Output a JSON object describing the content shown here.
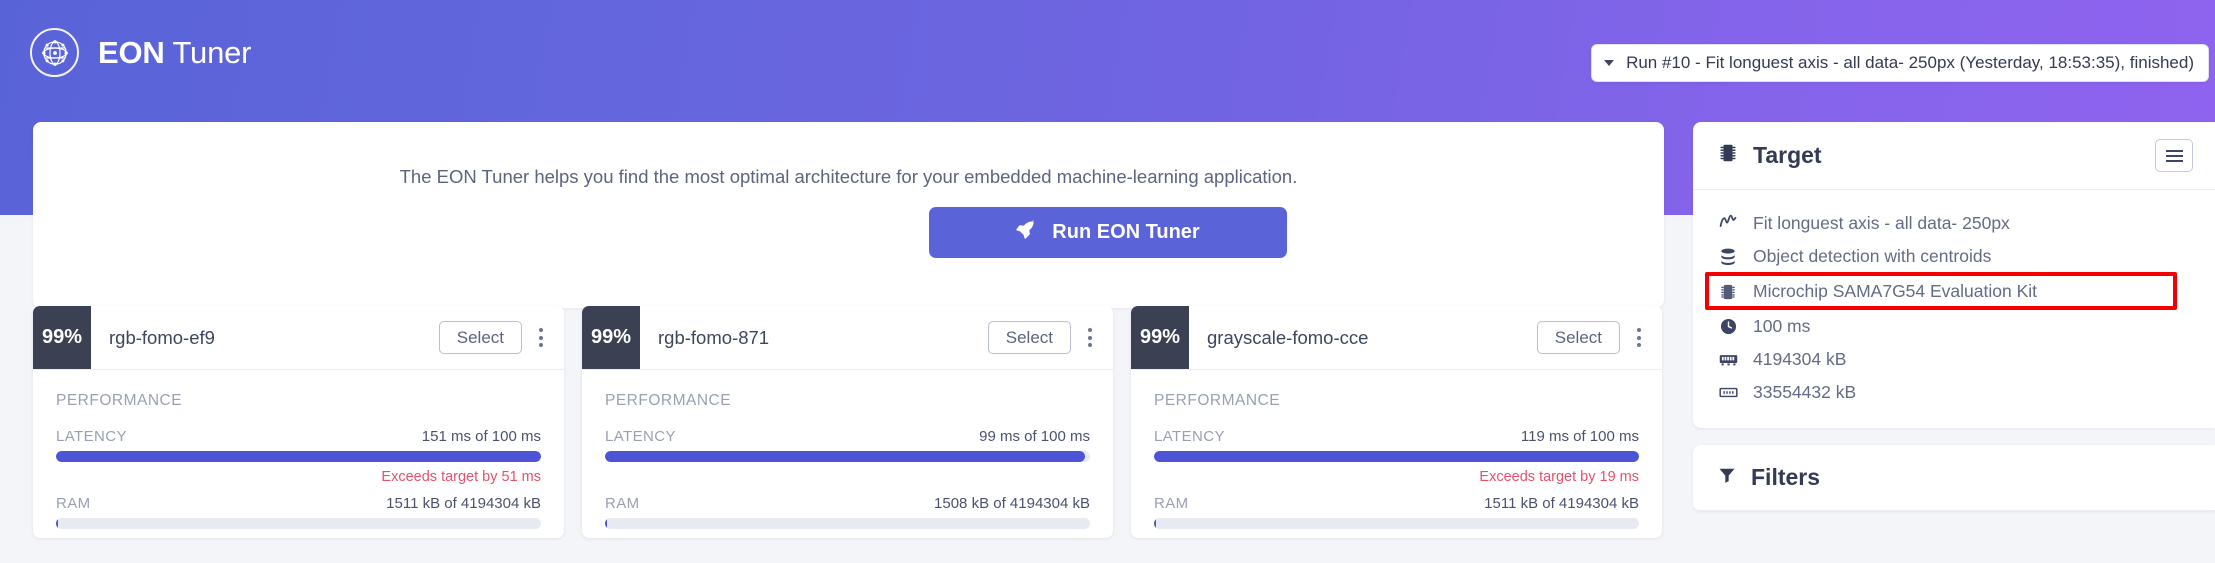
{
  "header": {
    "brand_bold": "EON",
    "brand_regular": "Tuner",
    "logo_icon": "eon-atom-logo-icon",
    "run_selector": {
      "caret_icon": "chevron-down-icon",
      "value": "Run #10 - Fit longuest axis - all data- 250px (Yesterday, 18:53:35), finished)"
    }
  },
  "intro": {
    "description": "The EON Tuner helps you find the most optimal architecture for your embedded machine-learning application.",
    "run_button_label": "Run EON Tuner",
    "run_button_icon": "rocket-icon",
    "accent_color": "#5a63d8"
  },
  "cards": [
    {
      "score": "99%",
      "name": "rgb-fomo-ef9",
      "select_label": "Select",
      "menu_icon": "kebab-menu-icon",
      "section_label": "PERFORMANCE",
      "metrics": [
        {
          "label": "LATENCY",
          "value": "151 ms of 100 ms",
          "fill_percent": 100,
          "warning": "Exceeds target by 51 ms"
        },
        {
          "label": "RAM",
          "value": "1511 kB of 4194304 kB",
          "fill_percent": 0,
          "warning": ""
        }
      ]
    },
    {
      "score": "99%",
      "name": "rgb-fomo-871",
      "select_label": "Select",
      "menu_icon": "kebab-menu-icon",
      "section_label": "PERFORMANCE",
      "metrics": [
        {
          "label": "LATENCY",
          "value": "99 ms of 100 ms",
          "fill_percent": 99,
          "warning": ""
        },
        {
          "label": "RAM",
          "value": "1508 kB of 4194304 kB",
          "fill_percent": 0,
          "warning": ""
        }
      ]
    },
    {
      "score": "99%",
      "name": "grayscale-fomo-cce",
      "select_label": "Select",
      "menu_icon": "kebab-menu-icon",
      "section_label": "PERFORMANCE",
      "metrics": [
        {
          "label": "LATENCY",
          "value": "119 ms of 100 ms",
          "fill_percent": 100,
          "warning": "Exceeds target by 19 ms"
        },
        {
          "label": "RAM",
          "value": "1511 kB of 4194304 kB",
          "fill_percent": 0,
          "warning": ""
        }
      ]
    }
  ],
  "sidebar": {
    "target_panel": {
      "title": "Target",
      "title_icon": "chip-icon",
      "menu_button_icon": "hamburger-menu-icon",
      "items": [
        {
          "icon": "signal-wave-icon",
          "label": "Fit longuest axis - all data- 250px",
          "highlighted": false
        },
        {
          "icon": "database-stack-icon",
          "label": "Object detection with centroids",
          "highlighted": false
        },
        {
          "icon": "chip-icon",
          "label": "Microchip SAMA7G54 Evaluation Kit",
          "highlighted": true
        },
        {
          "icon": "clock-icon",
          "label": "100 ms",
          "highlighted": false
        },
        {
          "icon": "memory-ram-icon",
          "label": "4194304 kB",
          "highlighted": false
        },
        {
          "icon": "memory-rom-icon",
          "label": "33554432 kB",
          "highlighted": false
        }
      ],
      "highlight_color": "#f40000"
    },
    "filters_panel": {
      "title": "Filters",
      "title_icon": "funnel-filter-icon"
    }
  }
}
